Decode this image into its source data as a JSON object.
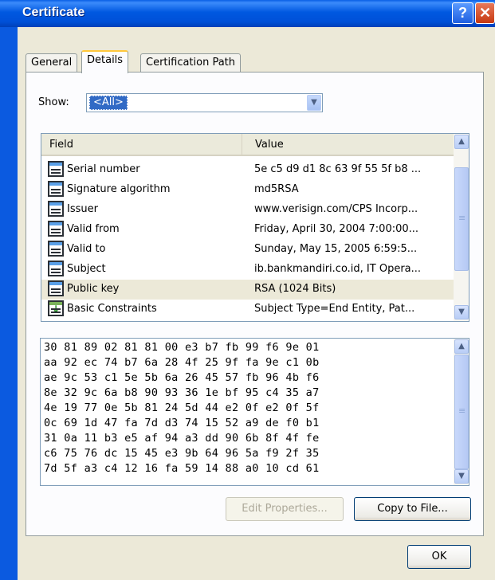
{
  "window": {
    "title": "Certificate",
    "help_glyph": "?",
    "close_glyph": "✕"
  },
  "tabs": [
    {
      "label": "General"
    },
    {
      "label": "Details"
    },
    {
      "label": "Certification Path"
    }
  ],
  "show": {
    "label": "Show:",
    "value": "<All>",
    "arrow": "▼"
  },
  "fields_list": {
    "headers": {
      "field": "Field",
      "value": "Value"
    },
    "rows": [
      {
        "field": "Serial number",
        "value": "5e c5 d9 d1 8c 63 9f 55 5f b8 ..."
      },
      {
        "field": "Signature algorithm",
        "value": "md5RSA"
      },
      {
        "field": "Issuer",
        "value": "www.verisign.com/CPS Incorp..."
      },
      {
        "field": "Valid from",
        "value": "Friday, April 30, 2004 7:00:00..."
      },
      {
        "field": "Valid to",
        "value": "Sunday, May 15, 2005 6:59:5..."
      },
      {
        "field": "Subject",
        "value": "ib.bankmandiri.co.id, IT Opera..."
      },
      {
        "field": "Public key",
        "value": "RSA (1024 Bits)"
      },
      {
        "field": "Basic Constraints",
        "value": "Subject Type=End Entity, Pat..."
      }
    ],
    "selected_row": "Public key"
  },
  "hex_dump": [
    "30 81 89 02 81 81 00 e3 b7 fb 99 f6 9e 01",
    "aa 92 ec 74 b7 6a 28 4f 25 9f fa 9e c1 0b",
    "ae 9c 53 c1 5e 5b 6a 26 45 57 fb 96 4b f6",
    "8e 32 9c 6a b8 90 93 36 1e bf 95 c4 35 a7",
    "4e 19 77 0e 5b 81 24 5d 44 e2 0f e2 0f 5f",
    "0c 69 1d 47 fa 7d d3 74 15 52 a9 de f0 b1",
    "31 0a 11 b3 e5 af 94 a3 dd 90 6b 8f 4f fe",
    "c6 75 76 dc 15 45 e3 9b 64 96 5a f9 2f 35",
    "7d 5f a3 c4 12 16 fa 59 14 88 a0 10 cd 61"
  ],
  "scroll_glyphs": {
    "up": "▲",
    "down": "▼"
  },
  "buttons": {
    "edit_properties": "Edit Properties...",
    "copy_to_file": "Copy to File...",
    "ok": "OK"
  },
  "colors": {
    "title_bar": "#0055e5",
    "selection": "#316ac5",
    "tab_highlight": "#ffc83c"
  }
}
